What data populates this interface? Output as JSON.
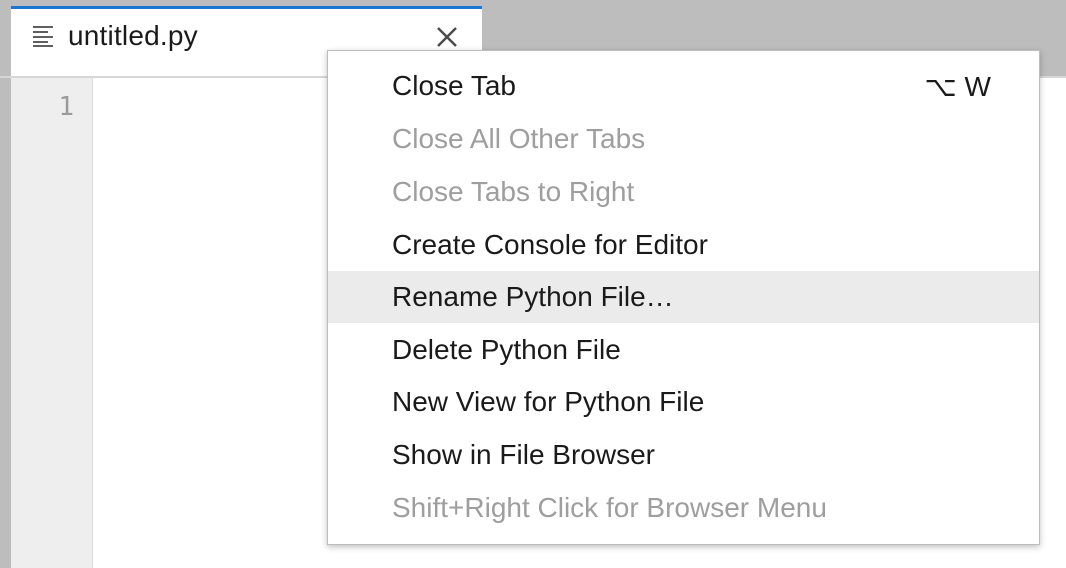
{
  "tab": {
    "icon": "text-file-icon",
    "title": "untitled.py",
    "close_icon": "close-icon"
  },
  "editor": {
    "line_numbers": [
      "1"
    ]
  },
  "context_menu": {
    "items": [
      {
        "label": "Close Tab",
        "shortcut": "⌥ W",
        "enabled": true,
        "highlighted": false
      },
      {
        "label": "Close All Other Tabs",
        "shortcut": "",
        "enabled": false,
        "highlighted": false
      },
      {
        "label": "Close Tabs to Right",
        "shortcut": "",
        "enabled": false,
        "highlighted": false
      },
      {
        "label": "Create Console for Editor",
        "shortcut": "",
        "enabled": true,
        "highlighted": false
      },
      {
        "label": "Rename Python File…",
        "shortcut": "",
        "enabled": true,
        "highlighted": true
      },
      {
        "label": "Delete Python File",
        "shortcut": "",
        "enabled": true,
        "highlighted": false
      },
      {
        "label": "New View for Python File",
        "shortcut": "",
        "enabled": true,
        "highlighted": false
      },
      {
        "label": "Show in File Browser",
        "shortcut": "",
        "enabled": true,
        "highlighted": false
      },
      {
        "label": "Shift+Right Click for Browser Menu",
        "shortcut": "",
        "enabled": false,
        "highlighted": false
      }
    ]
  },
  "colors": {
    "accent": "#1976d2",
    "disabled_text": "#9e9e9e",
    "highlight": "#ebebeb"
  }
}
